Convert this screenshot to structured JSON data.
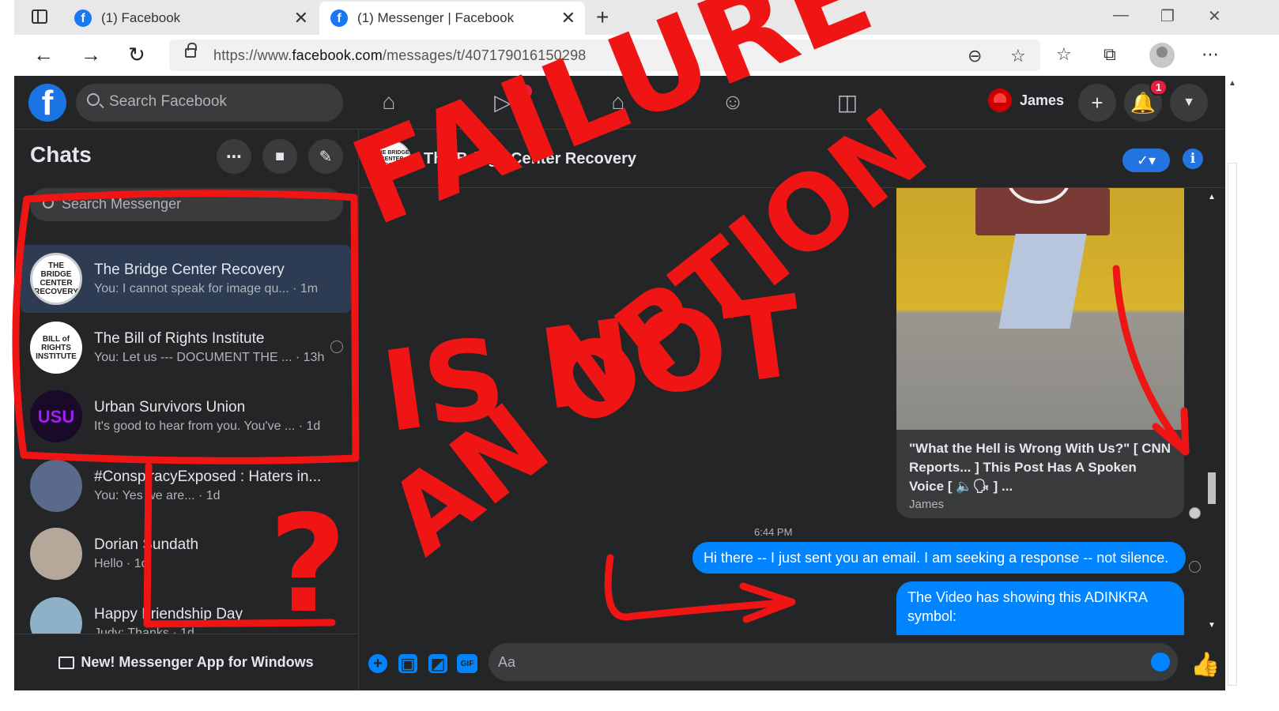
{
  "browser": {
    "tabs": [
      {
        "title": "(1) Facebook",
        "active": false
      },
      {
        "title": "(1) Messenger | Facebook",
        "active": true
      }
    ],
    "url_prefix": "https://www.",
    "url_domain": "facebook.com",
    "url_path": "/messages/t/407179016150298"
  },
  "facebook": {
    "search_placeholder": "Search Facebook",
    "watch_badge": "9+",
    "notifications_badge": "1",
    "profile_name": "James"
  },
  "sidebar": {
    "title": "Chats",
    "search_placeholder": "Search Messenger",
    "conversations": [
      {
        "name": "The Bridge Center Recovery",
        "preview": "You: I cannot speak for image qu...",
        "time": " · 1m",
        "avatar_text": "THE BRIDGE CENTER RECOVERY",
        "selected": true
      },
      {
        "name": "The Bill of Rights Institute",
        "preview": "You: Let us --- DOCUMENT THE ...",
        "time": " · 13h",
        "avatar_text": "BILL of RIGHTS INSTITUTE",
        "selected": false
      },
      {
        "name": "Urban Survivors Union",
        "preview": "It's good to hear from you. You've ...",
        "time": " · 1d",
        "avatar_text": "USU",
        "selected": false
      },
      {
        "name": "#ConspiracyExposed : Haters in...",
        "preview": "You: Yes we are...",
        "time": " · 1d",
        "avatar_text": "",
        "selected": false
      },
      {
        "name": "Dorian Sundath",
        "preview": "Hello",
        "time": " · 1d",
        "avatar_text": "",
        "selected": false
      },
      {
        "name": "Happy Friendship Day",
        "preview": "Judy: Thanks",
        "time": " · 1d",
        "avatar_text": "",
        "selected": false
      }
    ],
    "footer": "New! Messenger App for Windows"
  },
  "thread": {
    "name": "The Bridge Center Recovery",
    "avatar_text": "THE BRIDGE CENTER RECOVERY",
    "shared_post": {
      "title": "\"What the Hell is Wrong With Us?\" [ CNN Reports... ] This Post Has A Spoken Voice [ 🔈🗣 ] ...",
      "sender": "James"
    },
    "timestamp": "6:44 PM",
    "messages": [
      "Hi there -- I just sent you an email.  I am seeking a response -- not silence.",
      "The Video has showing this ADINKRA symbol:"
    ],
    "composer_placeholder": "Aa"
  },
  "annotation": {
    "line1": "FAILURE",
    "line2": "IS NOT",
    "line3": "AN OPTION",
    "question": "?",
    "color": "#ef1515"
  }
}
